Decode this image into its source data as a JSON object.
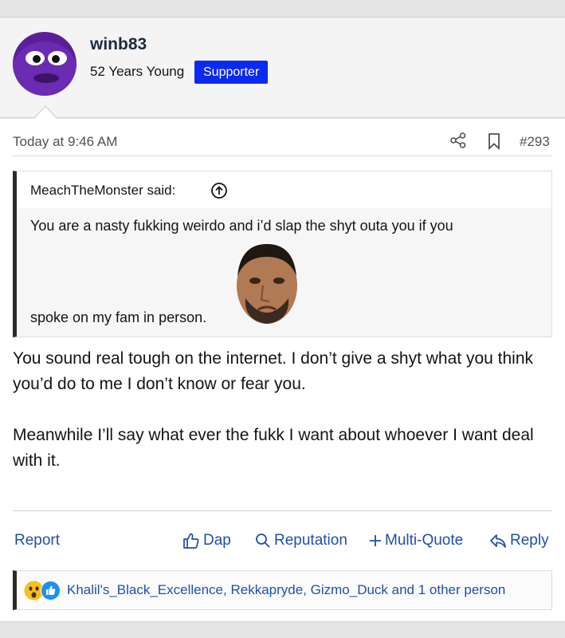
{
  "user": {
    "name": "winb83",
    "title": "52 Years Young",
    "badge": "Supporter"
  },
  "post": {
    "date": "Today at 9:46 AM",
    "number": "#293",
    "quote": {
      "author_line": "MeachTheMonster said:",
      "line1": "You are a nasty fukking weirdo and i’d slap the shyt outa you if you",
      "line2": "spoke on my fam in person."
    },
    "body": [
      "You sound real tough on the internet. I don’t give a shyt what you think you’d do to me I don’t know or fear you.",
      "Meanwhile I’ll say what ever the fukk I want about whoever I want deal with it."
    ]
  },
  "actions": {
    "report": "Report",
    "dap": "Dap",
    "reputation": "Reputation",
    "multi_quote": "Multi-Quote",
    "reply": "Reply"
  },
  "reactions": {
    "text": "Khalil's_Black_Excellence, Rekkapryde, Gizmo_Duck and 1 other person"
  },
  "colors": {
    "badge": "#0a2af0",
    "link": "#1f4fa6",
    "quote_border": "#2a2a2a",
    "avatar_purple": "#6b2bb3"
  },
  "icons": [
    "share-icon",
    "bookmark-icon",
    "arrow-up-circle-icon",
    "thumbs-up-icon",
    "search-icon",
    "plus-icon",
    "reply-icon",
    "wow-reaction-icon",
    "like-reaction-icon"
  ]
}
